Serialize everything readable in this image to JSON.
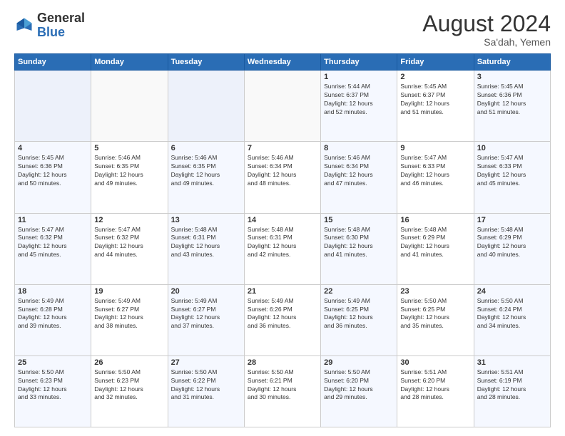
{
  "header": {
    "logo_general": "General",
    "logo_blue": "Blue",
    "month_title": "August 2024",
    "subtitle": "Sa'dah, Yemen"
  },
  "days_of_week": [
    "Sunday",
    "Monday",
    "Tuesday",
    "Wednesday",
    "Thursday",
    "Friday",
    "Saturday"
  ],
  "weeks": [
    [
      {
        "day": "",
        "info": ""
      },
      {
        "day": "",
        "info": ""
      },
      {
        "day": "",
        "info": ""
      },
      {
        "day": "",
        "info": ""
      },
      {
        "day": "1",
        "info": "Sunrise: 5:44 AM\nSunset: 6:37 PM\nDaylight: 12 hours\nand 52 minutes."
      },
      {
        "day": "2",
        "info": "Sunrise: 5:45 AM\nSunset: 6:37 PM\nDaylight: 12 hours\nand 51 minutes."
      },
      {
        "day": "3",
        "info": "Sunrise: 5:45 AM\nSunset: 6:36 PM\nDaylight: 12 hours\nand 51 minutes."
      }
    ],
    [
      {
        "day": "4",
        "info": "Sunrise: 5:45 AM\nSunset: 6:36 PM\nDaylight: 12 hours\nand 50 minutes."
      },
      {
        "day": "5",
        "info": "Sunrise: 5:46 AM\nSunset: 6:35 PM\nDaylight: 12 hours\nand 49 minutes."
      },
      {
        "day": "6",
        "info": "Sunrise: 5:46 AM\nSunset: 6:35 PM\nDaylight: 12 hours\nand 49 minutes."
      },
      {
        "day": "7",
        "info": "Sunrise: 5:46 AM\nSunset: 6:34 PM\nDaylight: 12 hours\nand 48 minutes."
      },
      {
        "day": "8",
        "info": "Sunrise: 5:46 AM\nSunset: 6:34 PM\nDaylight: 12 hours\nand 47 minutes."
      },
      {
        "day": "9",
        "info": "Sunrise: 5:47 AM\nSunset: 6:33 PM\nDaylight: 12 hours\nand 46 minutes."
      },
      {
        "day": "10",
        "info": "Sunrise: 5:47 AM\nSunset: 6:33 PM\nDaylight: 12 hours\nand 45 minutes."
      }
    ],
    [
      {
        "day": "11",
        "info": "Sunrise: 5:47 AM\nSunset: 6:32 PM\nDaylight: 12 hours\nand 45 minutes."
      },
      {
        "day": "12",
        "info": "Sunrise: 5:47 AM\nSunset: 6:32 PM\nDaylight: 12 hours\nand 44 minutes."
      },
      {
        "day": "13",
        "info": "Sunrise: 5:48 AM\nSunset: 6:31 PM\nDaylight: 12 hours\nand 43 minutes."
      },
      {
        "day": "14",
        "info": "Sunrise: 5:48 AM\nSunset: 6:31 PM\nDaylight: 12 hours\nand 42 minutes."
      },
      {
        "day": "15",
        "info": "Sunrise: 5:48 AM\nSunset: 6:30 PM\nDaylight: 12 hours\nand 41 minutes."
      },
      {
        "day": "16",
        "info": "Sunrise: 5:48 AM\nSunset: 6:29 PM\nDaylight: 12 hours\nand 41 minutes."
      },
      {
        "day": "17",
        "info": "Sunrise: 5:48 AM\nSunset: 6:29 PM\nDaylight: 12 hours\nand 40 minutes."
      }
    ],
    [
      {
        "day": "18",
        "info": "Sunrise: 5:49 AM\nSunset: 6:28 PM\nDaylight: 12 hours\nand 39 minutes."
      },
      {
        "day": "19",
        "info": "Sunrise: 5:49 AM\nSunset: 6:27 PM\nDaylight: 12 hours\nand 38 minutes."
      },
      {
        "day": "20",
        "info": "Sunrise: 5:49 AM\nSunset: 6:27 PM\nDaylight: 12 hours\nand 37 minutes."
      },
      {
        "day": "21",
        "info": "Sunrise: 5:49 AM\nSunset: 6:26 PM\nDaylight: 12 hours\nand 36 minutes."
      },
      {
        "day": "22",
        "info": "Sunrise: 5:49 AM\nSunset: 6:25 PM\nDaylight: 12 hours\nand 36 minutes."
      },
      {
        "day": "23",
        "info": "Sunrise: 5:50 AM\nSunset: 6:25 PM\nDaylight: 12 hours\nand 35 minutes."
      },
      {
        "day": "24",
        "info": "Sunrise: 5:50 AM\nSunset: 6:24 PM\nDaylight: 12 hours\nand 34 minutes."
      }
    ],
    [
      {
        "day": "25",
        "info": "Sunrise: 5:50 AM\nSunset: 6:23 PM\nDaylight: 12 hours\nand 33 minutes."
      },
      {
        "day": "26",
        "info": "Sunrise: 5:50 AM\nSunset: 6:23 PM\nDaylight: 12 hours\nand 32 minutes."
      },
      {
        "day": "27",
        "info": "Sunrise: 5:50 AM\nSunset: 6:22 PM\nDaylight: 12 hours\nand 31 minutes."
      },
      {
        "day": "28",
        "info": "Sunrise: 5:50 AM\nSunset: 6:21 PM\nDaylight: 12 hours\nand 30 minutes."
      },
      {
        "day": "29",
        "info": "Sunrise: 5:50 AM\nSunset: 6:20 PM\nDaylight: 12 hours\nand 29 minutes."
      },
      {
        "day": "30",
        "info": "Sunrise: 5:51 AM\nSunset: 6:20 PM\nDaylight: 12 hours\nand 28 minutes."
      },
      {
        "day": "31",
        "info": "Sunrise: 5:51 AM\nSunset: 6:19 PM\nDaylight: 12 hours\nand 28 minutes."
      }
    ]
  ]
}
